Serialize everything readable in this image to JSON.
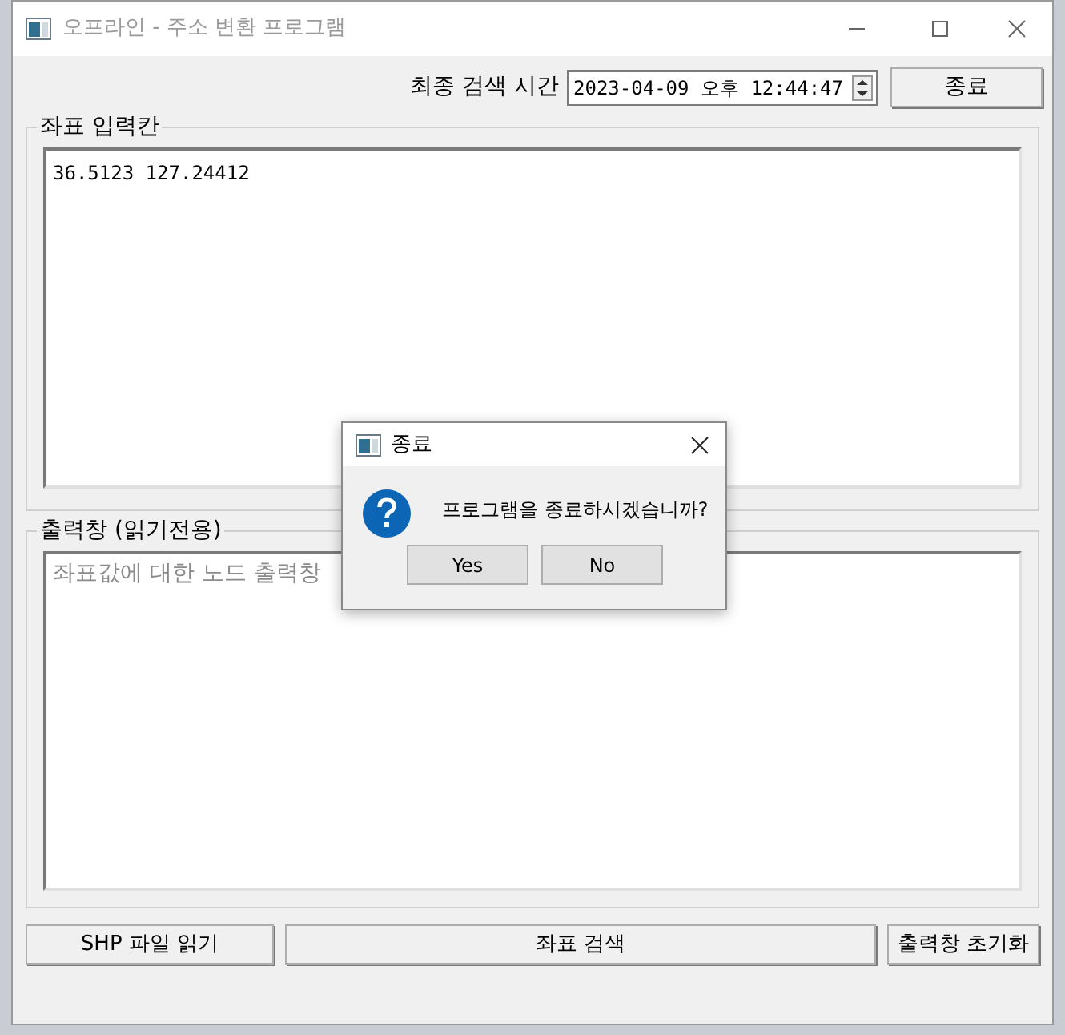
{
  "window": {
    "title": "오프라인 - 주소 변환 프로그램"
  },
  "toolbar": {
    "label": "최종 검색 시간",
    "datetime": "2023-04-09 오후 12:44:47",
    "button": "종료"
  },
  "input_group": {
    "title": "좌표 입력칸",
    "value": "36.5123 127.24412"
  },
  "output_group": {
    "title": "출력창 (읽기전용)",
    "placeholder": "좌표값에 대한 노드 출력창"
  },
  "buttons": [
    "SHP 파일 읽기",
    "좌표 검색",
    "출력창 초기화"
  ],
  "dialog": {
    "title": "종료",
    "message": "프로그램을 종료하시겠습니까?",
    "buttons": [
      "Yes",
      "No"
    ]
  }
}
